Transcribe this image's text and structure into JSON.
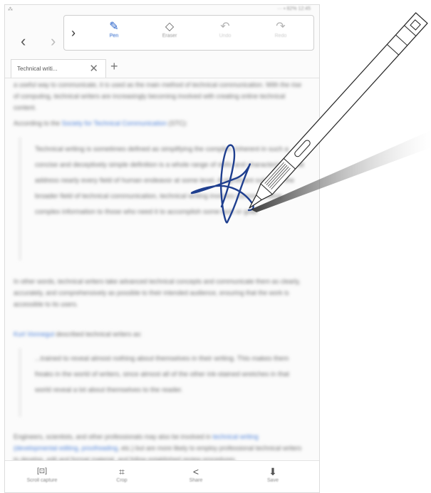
{
  "status": {
    "left": "⁂",
    "right": "··· ▪ 82% 12:45"
  },
  "nav": {
    "back_icon": "‹",
    "forward_icon": "›"
  },
  "toolbar": {
    "expand_icon": "›",
    "tools": [
      {
        "name": "pen",
        "label": "Pen",
        "icon": "✎",
        "active": true
      },
      {
        "name": "eraser",
        "label": "Eraser",
        "icon": "◇",
        "active": false
      },
      {
        "name": "undo",
        "label": "Undo",
        "icon": "↶",
        "active": false
      },
      {
        "name": "redo",
        "label": "Redo",
        "icon": "↷",
        "active": false
      }
    ]
  },
  "tab": {
    "title": "Technical writi...",
    "close_icon": "✕",
    "new_tab_icon": "+"
  },
  "article": {
    "intro": "a useful way to communicate, it is used as the main method of technical communication. With the rise of computing, technical writers are increasingly becoming involved with creating online technical content.",
    "according_prefix": "According to the ",
    "according_link": "Society for Technical Communication",
    "according_suffix": " (STC):",
    "quote1": "Technical writing is sometimes defined as simplifying the complex. Inherent in such a concise and deceptively simple definition is a whole range of skills and characteristics that address nearly every field of human endeavor at some level. A significant subset of the broader field of technical communication, technical writing involves communicating complex information to those who need it to accomplish some task or goal.",
    "para2": "In other words, technical writers take advanced technical concepts and communicate them as clearly, accurately, and comprehensively as possible to their intended audience, ensuring that the work is accessible to its users.",
    "kurt_link": "Kurt Vonnegut",
    "kurt_suffix": " described technical writers as:",
    "quote2": "...trained to reveal almost nothing about themselves in their writing. This makes them freaks in the world of writers, since almost all of the other ink-stained wretches in that world reveal a lot about themselves to the reader.",
    "para3_prefix": "Engineers, scientists, and other professionals may also be involved in ",
    "para3_link": "technical writing (developmental editing, proofreading",
    "para3_suffix": ", etc.) but are more likely to employ professional technical writers to develop, edit and format material, and follow established review procedures."
  },
  "bottombar": {
    "items": [
      {
        "name": "scroll-capture",
        "label": "Scroll capture",
        "icon": "[⊡]"
      },
      {
        "name": "crop",
        "label": "Crop",
        "icon": "⌗"
      },
      {
        "name": "share",
        "label": "Share",
        "icon": "<"
      },
      {
        "name": "save",
        "label": "Save",
        "icon": "⬇"
      }
    ]
  },
  "colors": {
    "ink": "#1f3f8f",
    "accent": "#1e5cc8",
    "link": "#4a7fd8"
  }
}
